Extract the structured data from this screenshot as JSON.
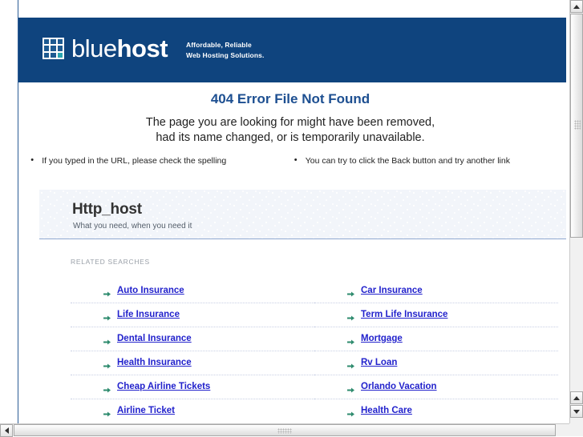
{
  "header": {
    "logo_text_light": "blue",
    "logo_text_bold": "host",
    "logo_icon": "grid-squares-icon",
    "tagline_line1": "Affordable, Reliable",
    "tagline_line2": "Web Hosting Solutions.",
    "background_color": "#0f447e",
    "accent_color": "#2aa5b0"
  },
  "error": {
    "title": "404 Error File Not Found",
    "message_line1": "The page you are looking for might have been removed,",
    "message_line2": "had its name changed, or is temporarily unavailable.",
    "bullets": [
      "If you typed in the URL, please check the spelling",
      "You can try to click the Back button and try another link"
    ],
    "title_color": "#1d4f91"
  },
  "host_panel": {
    "title": "Http_host",
    "subtitle": "What you need, when you need it"
  },
  "related": {
    "heading": "RELATED SEARCHES",
    "link_color": "#2222cc",
    "bullet_icon": "arrow-right-icon",
    "rows": [
      {
        "left": "Auto Insurance",
        "right": "Car Insurance"
      },
      {
        "left": "Life Insurance",
        "right": "Term Life Insurance"
      },
      {
        "left": "Dental Insurance",
        "right": "Mortgage"
      },
      {
        "left": "Health Insurance",
        "right": "Rv Loan"
      },
      {
        "left": "Cheap Airline Tickets",
        "right": "Orlando Vacation"
      },
      {
        "left": "Airline Ticket",
        "right": "Health Care"
      }
    ]
  },
  "scrollbars": {
    "vertical_up_icon": "triangle-up-icon",
    "vertical_down_icon": "triangle-down-icon",
    "horizontal_left_icon": "triangle-left-icon",
    "horizontal_right_icon": "triangle-right-icon"
  }
}
